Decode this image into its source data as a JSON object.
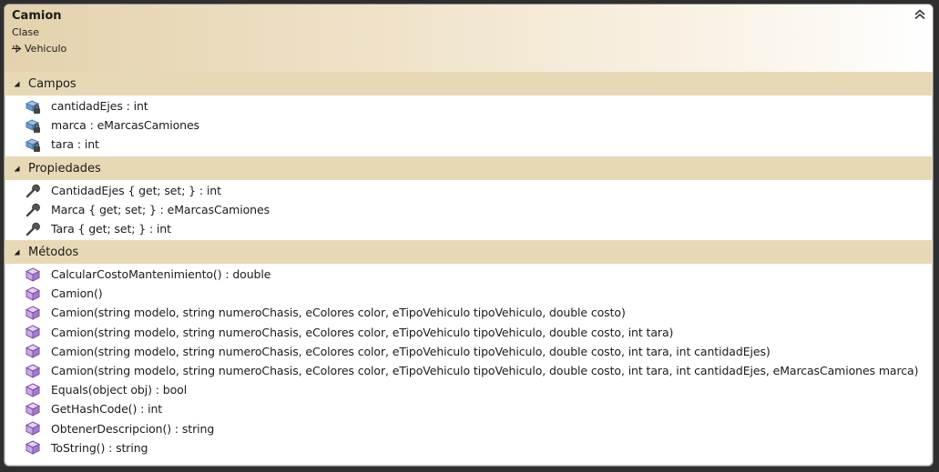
{
  "class": {
    "name": "Camion",
    "stereotype": "Clase",
    "base_class": "Vehiculo"
  },
  "sections": {
    "campos": {
      "label": "Campos",
      "items": [
        "cantidadEjes : int",
        "marca : eMarcasCamiones",
        "tara : int"
      ]
    },
    "propiedades": {
      "label": "Propiedades",
      "items": [
        "CantidadEjes { get; set; } : int",
        "Marca { get; set; } : eMarcasCamiones",
        "Tara { get; set; } : int"
      ]
    },
    "metodos": {
      "label": "Métodos",
      "items": [
        "CalcularCostoMantenimiento() : double",
        "Camion()",
        "Camion(string modelo, string numeroChasis, eColores color, eTipoVehiculo tipoVehiculo, double costo)",
        "Camion(string modelo, string numeroChasis, eColores color, eTipoVehiculo tipoVehiculo, double costo, int tara)",
        "Camion(string modelo, string numeroChasis, eColores color, eTipoVehiculo tipoVehiculo, double costo, int tara, int cantidadEjes)",
        "Camion(string modelo, string numeroChasis, eColores color, eTipoVehiculo tipoVehiculo, double costo, int tara, int cantidadEjes, eMarcasCamiones marca)",
        "Equals(object obj) : bool",
        "GetHashCode() : int",
        "ObtenerDescripcion() : string",
        "ToString() : string"
      ]
    }
  },
  "icons": {
    "collapse": "double-chevron-up-icon",
    "section_toggle": "triangle-expanded-icon",
    "field": "private-field-icon",
    "property": "wrench-property-icon",
    "method": "method-cube-icon",
    "inherit": "inheritance-arrow-icon"
  },
  "colors": {
    "header_gradient_start": "#e3d2ad",
    "section_header": "#e8d9b6",
    "field_icon": "#5a84b8",
    "method_icon": "#8a5fb3"
  }
}
